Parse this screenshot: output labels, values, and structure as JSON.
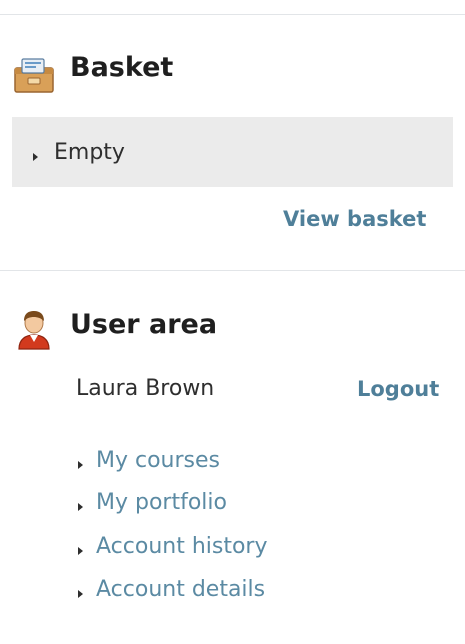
{
  "basket": {
    "title": "Basket",
    "icon": "basket-box-icon",
    "status": "Empty",
    "view_link": "View basket"
  },
  "user_area": {
    "title": "User area",
    "icon": "user-icon",
    "user_name": "Laura Brown",
    "logout": "Logout",
    "links": [
      {
        "label": "My courses"
      },
      {
        "label": "My portfolio"
      },
      {
        "label": "Account history"
      },
      {
        "label": "Account details"
      }
    ]
  },
  "colors": {
    "link": "#5b8aa3",
    "link_bold": "#4f7f99",
    "panel_bg": "#ebebeb",
    "divider": "#e2e5e8"
  }
}
